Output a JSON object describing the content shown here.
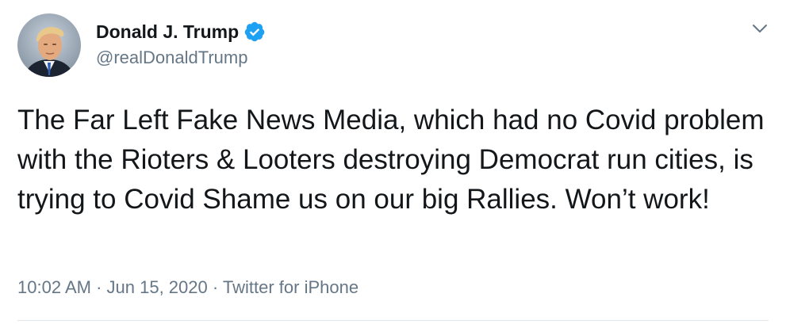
{
  "tweet": {
    "author": {
      "display_name": "Donald J. Trump",
      "handle": "@realDonaldTrump",
      "verified": true,
      "avatar_icon": "profile-photo",
      "verified_icon": "verified-badge-icon",
      "verified_color": "#1da1f2"
    },
    "text": "The Far Left Fake News Media, which had no Covid problem with the Rioters & Looters destroying Democrat run cities, is trying to Covid Shame us on our big Rallies. Won’t work!",
    "time": "10:02 AM",
    "separator": " · ",
    "date": "Jun 15, 2020",
    "source": "Twitter for iPhone",
    "menu_icon": "chevron-down-icon"
  },
  "colors": {
    "text": "#14171a",
    "secondary": "#657786",
    "divider": "#e1e8ed"
  }
}
